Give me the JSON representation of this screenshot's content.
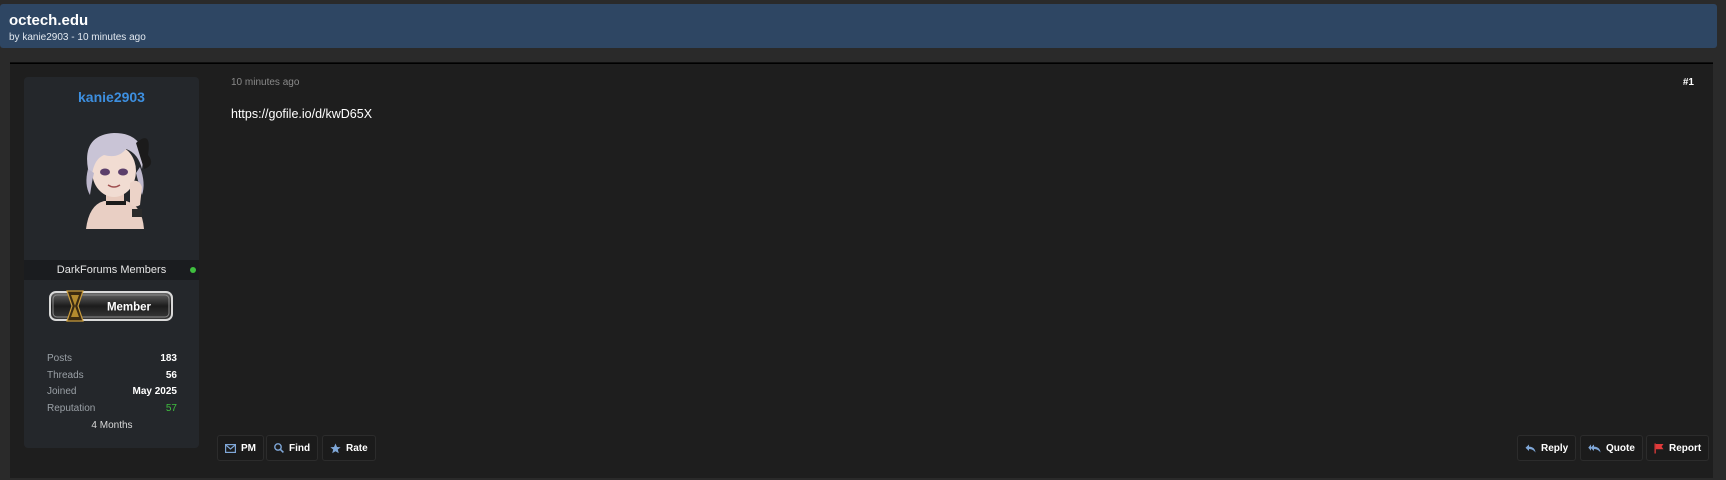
{
  "thread": {
    "title": "octech.edu",
    "meta": "by kanie2903 - 10 minutes ago"
  },
  "author": {
    "username": "kanie2903",
    "group": "DarkForums Members",
    "badge_text": "Member",
    "status_color": "#3fbf3f",
    "stats": [
      {
        "label": "Posts",
        "value": "183"
      },
      {
        "label": "Threads",
        "value": "56"
      },
      {
        "label": "Joined",
        "value": "May 2025"
      },
      {
        "label": "Reputation",
        "value": "57"
      }
    ],
    "membership_duration": "4 Months"
  },
  "post": {
    "date": "10 minutes ago",
    "number": "#1",
    "body": "https://gofile.io/d/kwD65X"
  },
  "actions_left": [
    {
      "label": "PM",
      "icon": "envelope-icon"
    },
    {
      "label": "Find",
      "icon": "search-icon"
    },
    {
      "label": "Rate",
      "icon": "star-icon"
    }
  ],
  "actions_right": [
    {
      "label": "Reply",
      "icon": "reply-icon"
    },
    {
      "label": "Quote",
      "icon": "quote-icon"
    },
    {
      "label": "Report",
      "icon": "flag-icon"
    }
  ],
  "colors": {
    "header_bg": "#2e4663",
    "username": "#3d8fe0",
    "reputation": "#3fbf3f",
    "report_flag": "#e03a3a",
    "icon_blue": "#7fa7d8"
  }
}
